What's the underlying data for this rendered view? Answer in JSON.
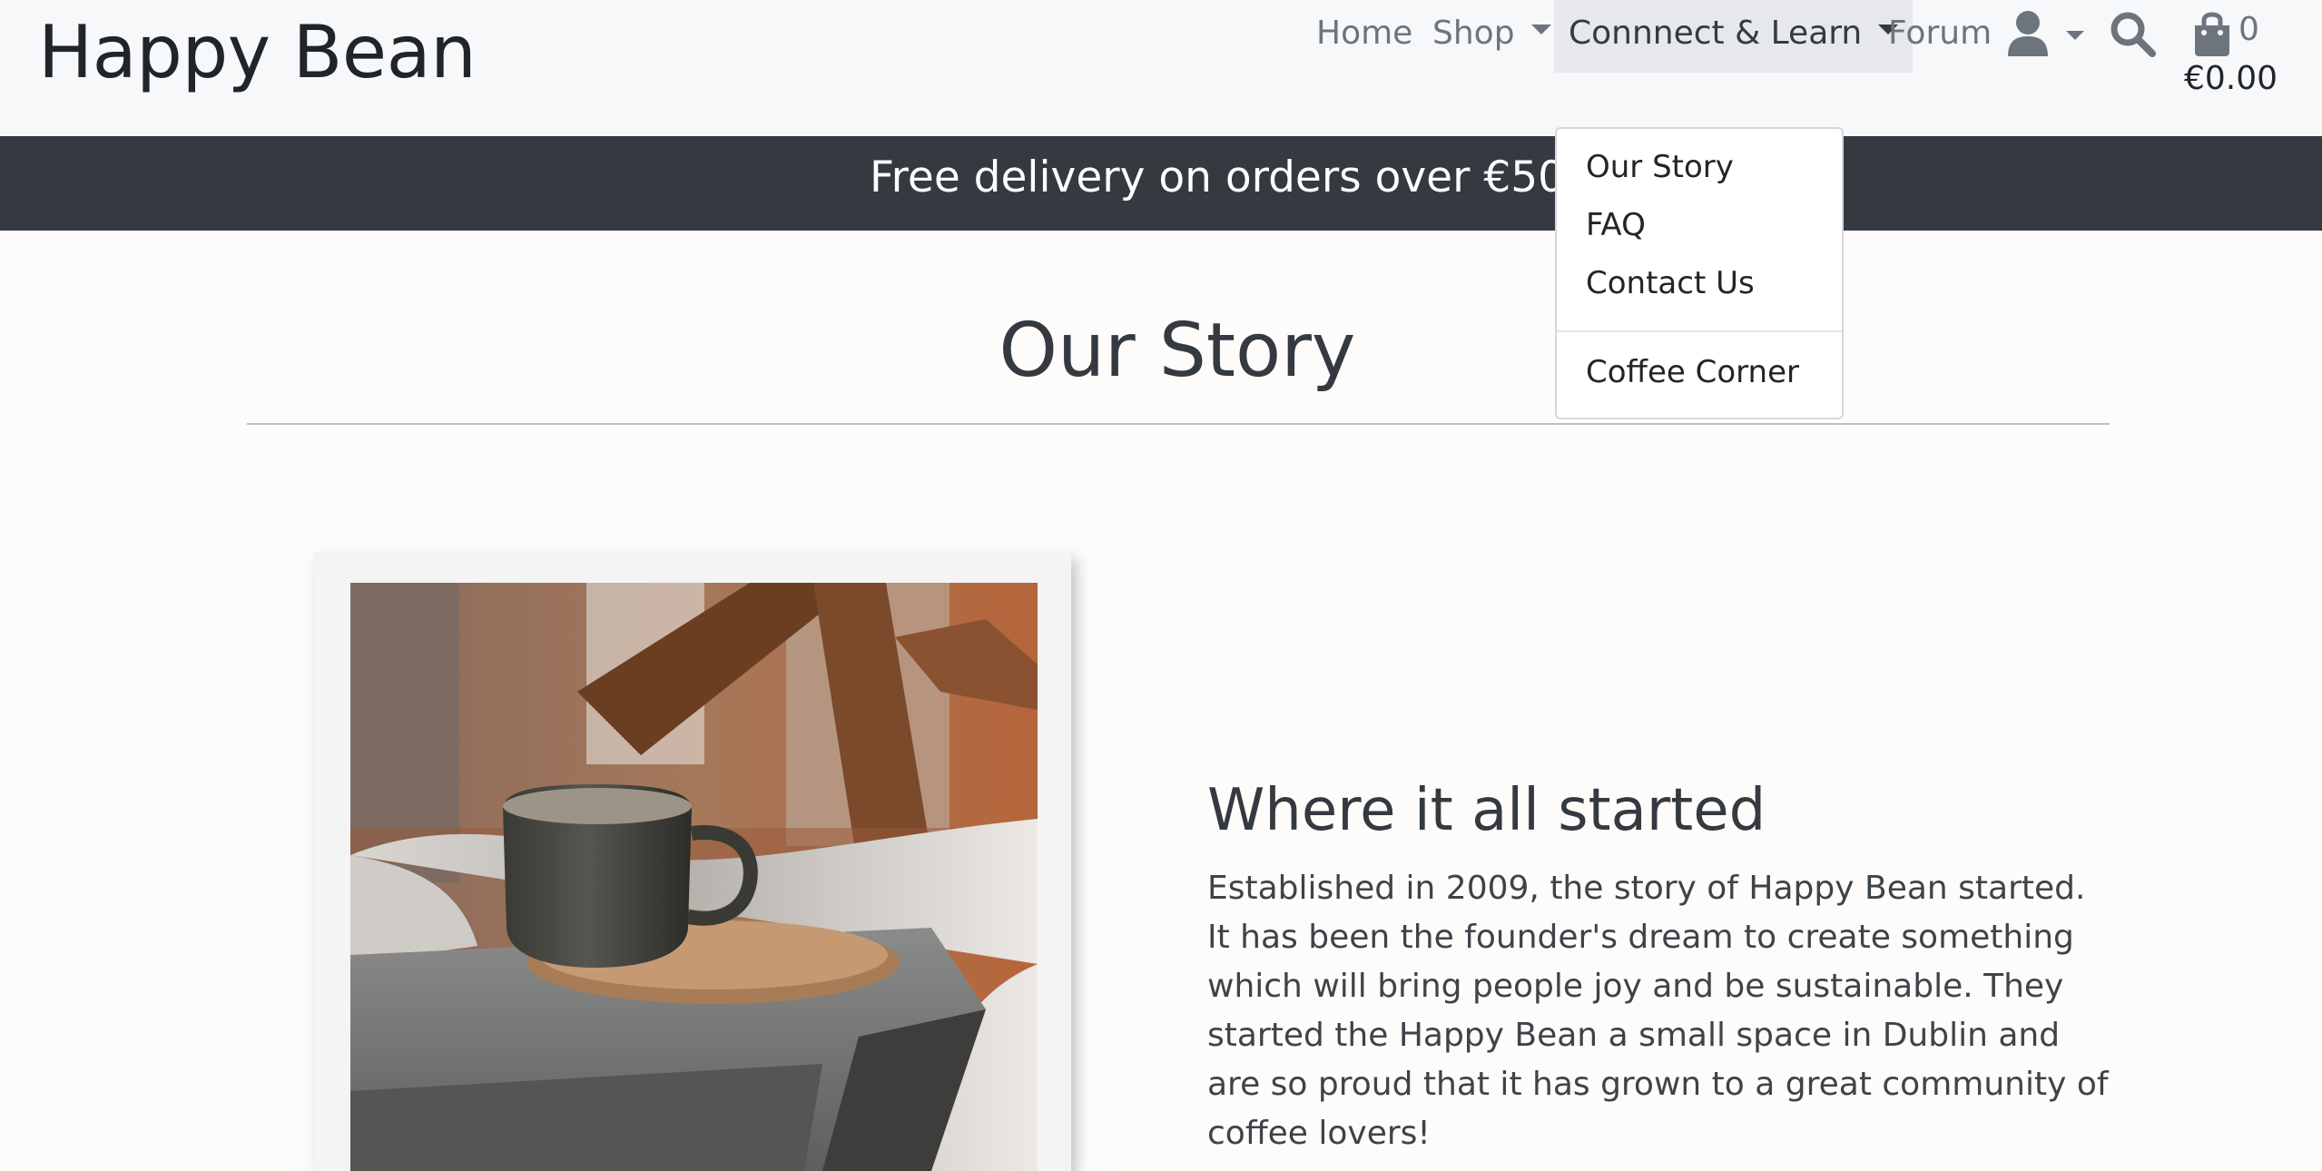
{
  "brand": {
    "name": "Happy Bean"
  },
  "nav": {
    "home": "Home",
    "shop": "Shop",
    "connect_learn": "Connnect & Learn",
    "forum": "Forum",
    "icons": [
      "user-icon",
      "search-icon",
      "shopping-bag-icon"
    ]
  },
  "cart": {
    "count": "0",
    "total": "€0.00"
  },
  "banner": {
    "text": "Free delivery on orders over €50"
  },
  "dropdown": {
    "items": [
      "Our Story",
      "FAQ",
      "Contact Us"
    ],
    "extra_item": "Coffee Corner"
  },
  "page": {
    "title": "Our Story",
    "section_heading": "Where it all started",
    "section_body": "Established in 2009, the story of Happy Bean started. It has been the founder's dream to create something which will bring people joy and be sustainable. They started the Happy Bean a small space in Dublin and are so proud that it has grown to a great community of coffee lovers!"
  },
  "colors": {
    "banner_bg": "#343a40",
    "header_bg": "#f7f8fa",
    "active_nav_bg": "#e6e8eb",
    "text_dark": "#343a40",
    "text_muted": "#6c757d"
  }
}
